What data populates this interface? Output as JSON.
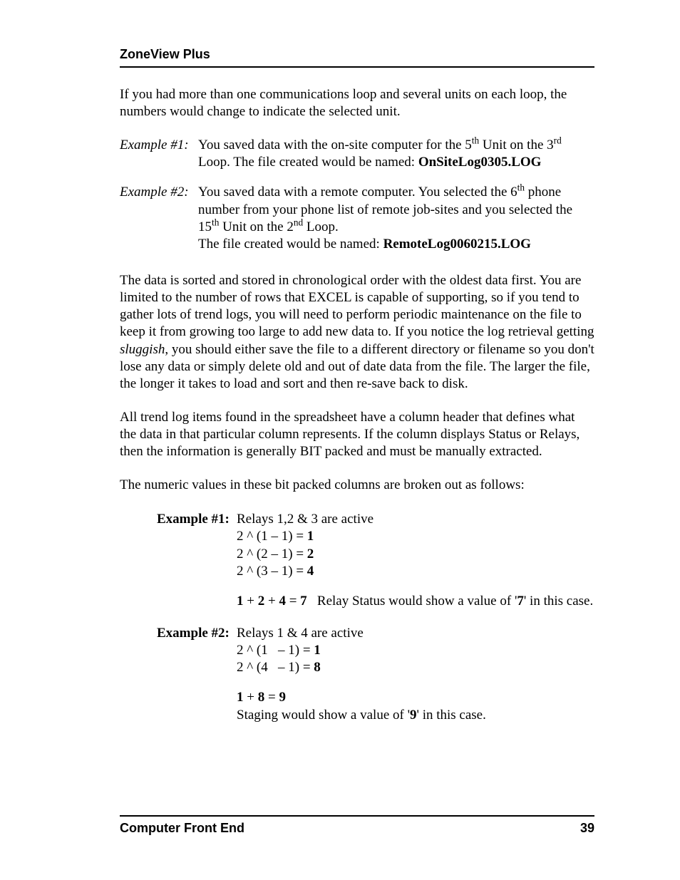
{
  "header": {
    "title": "ZoneView Plus"
  },
  "intro_para": "If you had more than one communications loop and several units on each loop, the numbers would change to indicate the selected unit.",
  "file_examples": [
    {
      "label": "Example #1:",
      "text_before": "You saved data with the on-site computer for the 5",
      "sup1": "th",
      "text_mid1": " Unit on the 3",
      "sup2": "rd",
      "text_mid2": " Loop. The file created would be named:  ",
      "filename": "OnSiteLog0305.LOG"
    },
    {
      "label": "Example #2:",
      "text_before": "You saved data with a remote computer. You selected the 6",
      "sup1": "th",
      "text_mid1": " phone number from your phone list of remote job-sites and you selected the 15",
      "sup2": "th",
      "text_mid2": " Unit on the 2",
      "sup3": "nd",
      "text_mid3": " Loop.",
      "line2_prefix": "The file created would be named: ",
      "filename": "RemoteLog0060215.LOG"
    }
  ],
  "para_sorted_prefix": "The data is sorted and stored in chronological order with the oldest data first. You are limited to the number of rows that EXCEL is capable of supporting, so if you tend to gather lots of trend logs, you will need to perform periodic maintenance on the file to keep it from growing too large to add new data to. If you notice the log retrieval getting ",
  "para_sorted_italic": "sluggish",
  "para_sorted_suffix": ", you should either save the file to a different directory or filename so you don't lose any data or simply delete old and out of date data from the file. The larger the file, the longer it takes to load and sort and then re-save back to disk.",
  "para_columns": "All trend log items found in the spreadsheet have a column header that defines what the data in that particular column represents. If the column displays Status or Relays, then the information is generally BIT packed and must be manually extracted.",
  "para_numeric": "The numeric values in these bit packed columns are broken out as follows:",
  "bit_examples": [
    {
      "label": "Example #1:",
      "title": "Relays 1,2 & 3 are active",
      "calc_lines": [
        {
          "pre": "2 ^ (1 – 1) = ",
          "bold": "1"
        },
        {
          "pre": "2 ^ (2 – 1) = ",
          "bold": "2"
        },
        {
          "pre": "2 ^ (3 – 1) = ",
          "bold": "4"
        }
      ],
      "sum_parts": [
        "1",
        " + ",
        "2",
        " + ",
        "4",
        " = ",
        "7"
      ],
      "sum_suffix_pre": "   Relay Status would show a value of '",
      "sum_value": "7",
      "sum_suffix_post": "' in this case."
    },
    {
      "label": "Example #2:",
      "title": "Relays 1 & 4  are active",
      "calc_lines": [
        {
          "pre": "2 ^ (1   – 1) = ",
          "bold": "1"
        },
        {
          "pre": "2 ^ (4   – 1) = ",
          "bold": "8"
        }
      ],
      "sum_parts": [
        "1",
        " + ",
        "8",
        " = ",
        "9"
      ],
      "result_line_pre": "Staging would show a value of '",
      "result_value": "9",
      "result_line_post": "' in this case."
    }
  ],
  "footer": {
    "left": "Computer Front End",
    "right": "39"
  }
}
